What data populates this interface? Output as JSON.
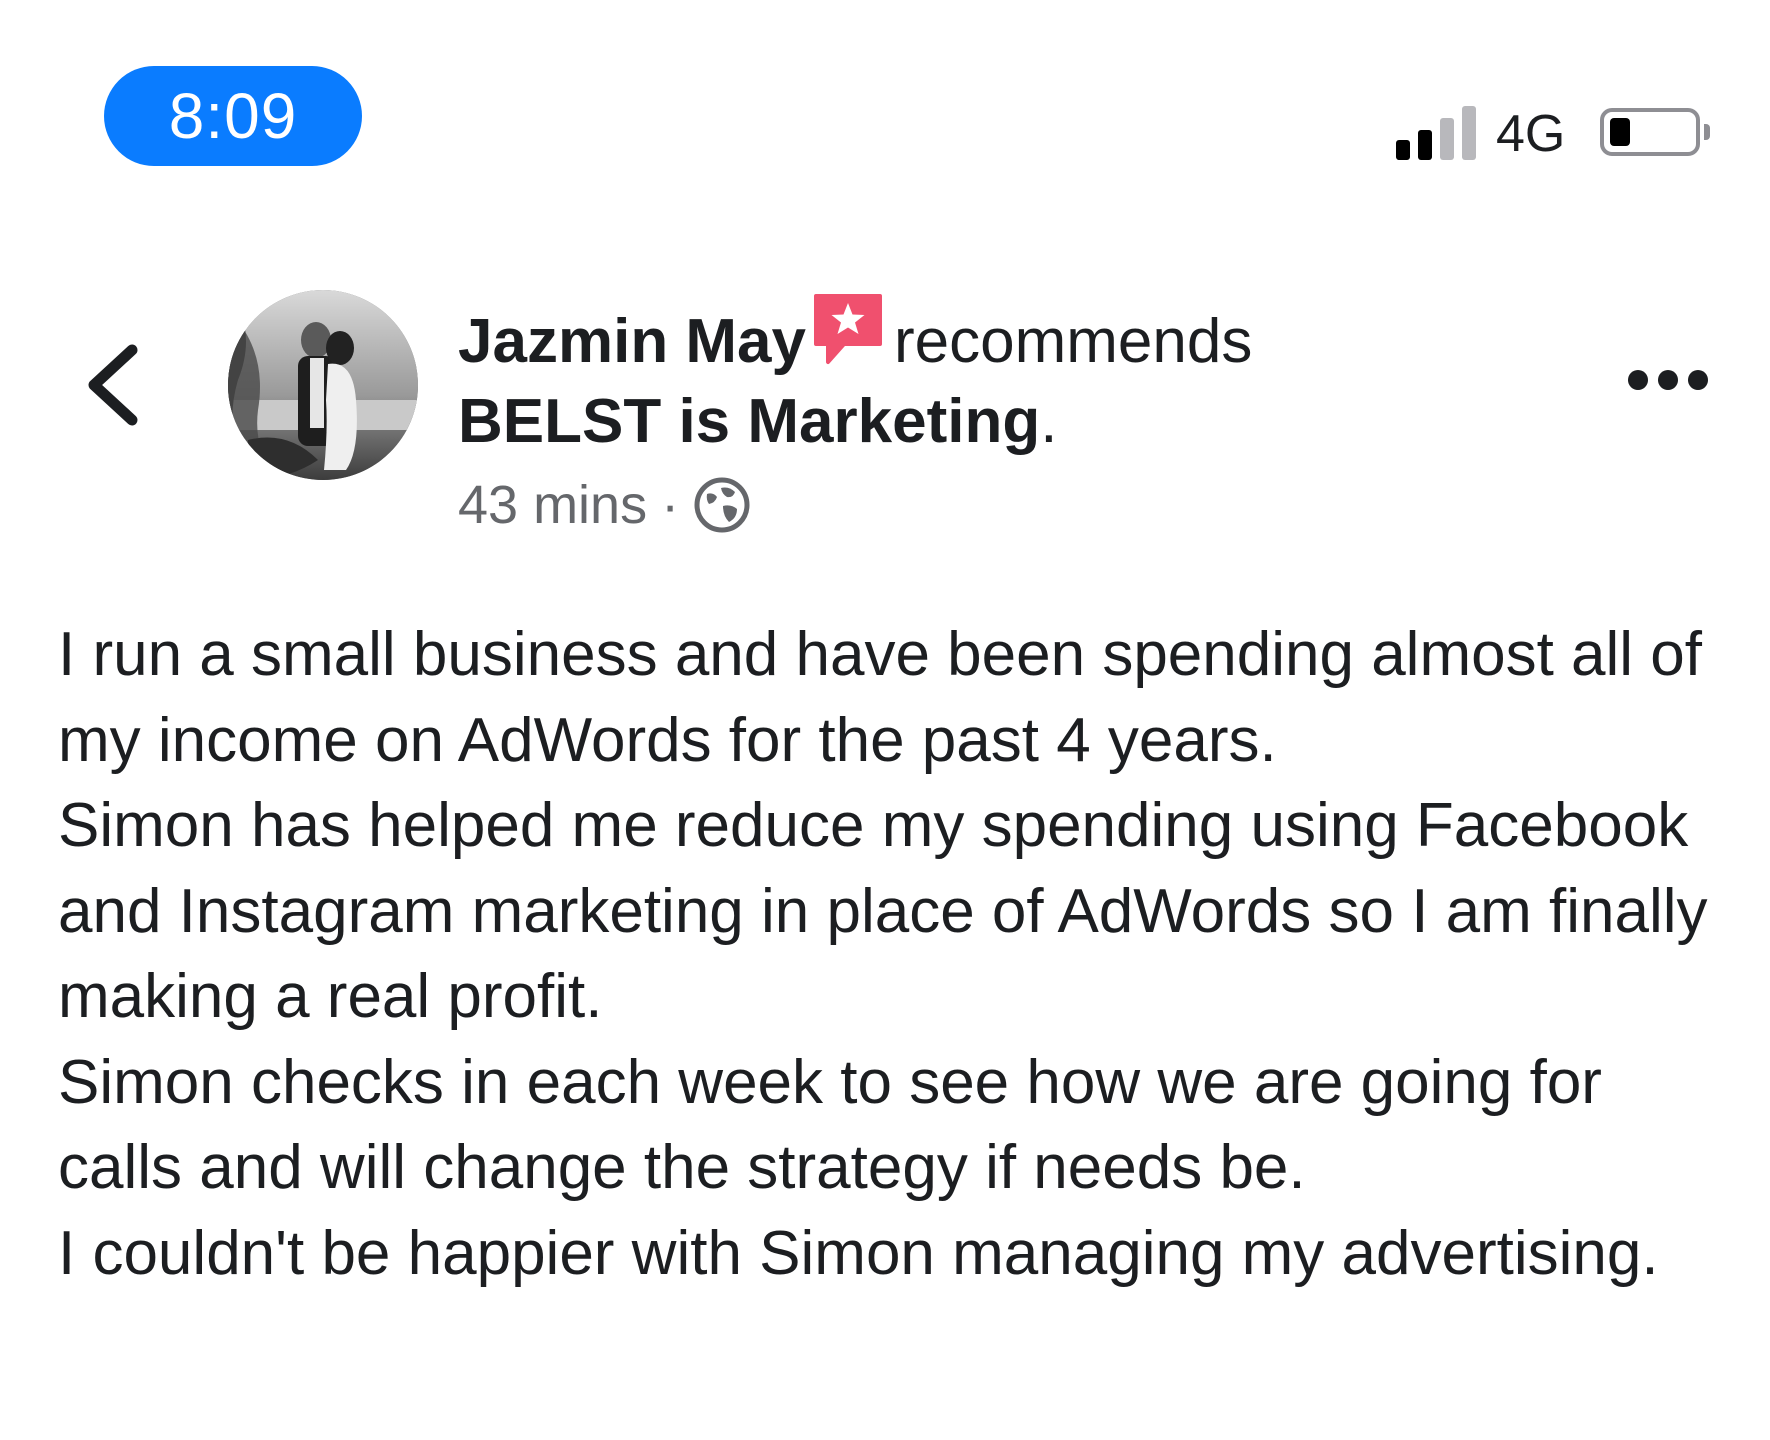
{
  "status_bar": {
    "time": "8:09",
    "network": "4G",
    "signal_bars_filled": 2,
    "signal_bars_total": 4,
    "battery_level_percent": 15,
    "time_pill_color": "#0a7cff"
  },
  "post": {
    "author": "Jazmin May",
    "action": "recommends",
    "page": "BELST is Marketing",
    "page_suffix": ".",
    "timestamp": "43 mins",
    "separator": "·",
    "privacy_icon": "globe-icon",
    "badge_icon": "recommendation-star-icon",
    "badge_color": "#f0506e",
    "body_paragraphs": [
      "I run a small business and have been spending almost all of my income on AdWords for the past 4 years.",
      "Simon has helped me reduce my spending using Facebook and Instagram marketing in place of AdWords so I am finally making a real profit.",
      "Simon checks in each week to see how we are going for calls and will change the strategy if needs be.",
      "I couldn't be happier with Simon managing my advertising."
    ]
  },
  "icons": {
    "back": "chevron-left-icon",
    "more": "more-options-icon",
    "avatar": "avatar"
  }
}
